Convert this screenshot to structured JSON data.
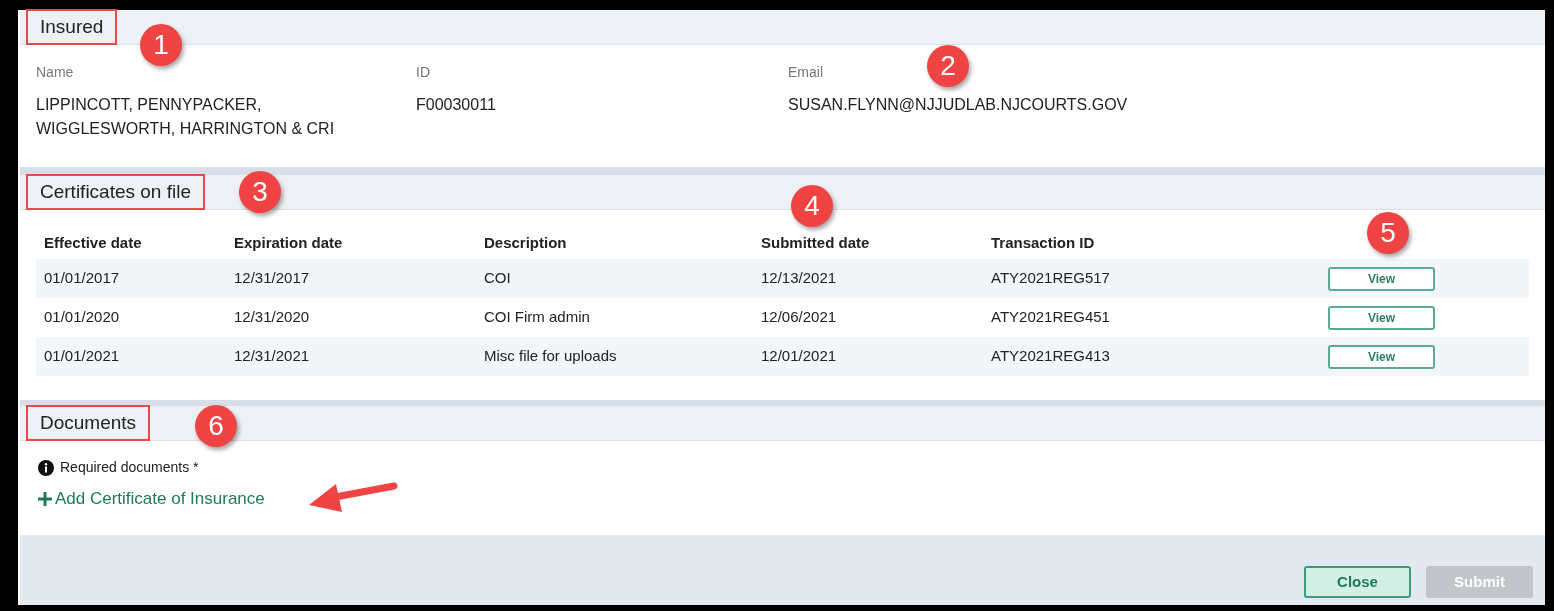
{
  "insured": {
    "title": "Insured",
    "highlighted": true,
    "fields": [
      {
        "label": "Name",
        "value": "LIPPINCOTT, PENNYPACKER, WIGGLESWORTH, HARRINGTON & CRI"
      },
      {
        "label": "ID",
        "value": "F00030011"
      },
      {
        "label": "Email",
        "value": "SUSAN.FLYNN@NJJUDLAB.NJCOURTS.GOV"
      }
    ]
  },
  "certificates": {
    "title": "Certificates on file",
    "highlighted": true,
    "columns": [
      "Effective date",
      "Expiration date",
      "Description",
      "Submitted date",
      "Transaction ID"
    ],
    "rows": [
      {
        "cells": [
          "01/01/2017",
          "12/31/2017",
          "COI",
          "12/13/2021",
          "ATY2021REG517"
        ],
        "action": "View"
      },
      {
        "cells": [
          "01/01/2020",
          "12/31/2020",
          "COI Firm admin",
          "12/06/2021",
          "ATY2021REG451"
        ],
        "action": "View"
      },
      {
        "cells": [
          "01/01/2021",
          "12/31/2021",
          "Misc file for uploads",
          "12/01/2021",
          "ATY2021REG413"
        ],
        "action": "View"
      }
    ]
  },
  "documents": {
    "title": "Documents",
    "highlighted": true,
    "note": "Required documents *",
    "add_link": "Add Certificate of Insurance"
  },
  "buttons": [
    {
      "label": "Close",
      "disabled": false
    },
    {
      "label": "Submit",
      "disabled": true
    }
  ],
  "callouts": [
    "1",
    "2",
    "3",
    "4",
    "5",
    "6"
  ]
}
